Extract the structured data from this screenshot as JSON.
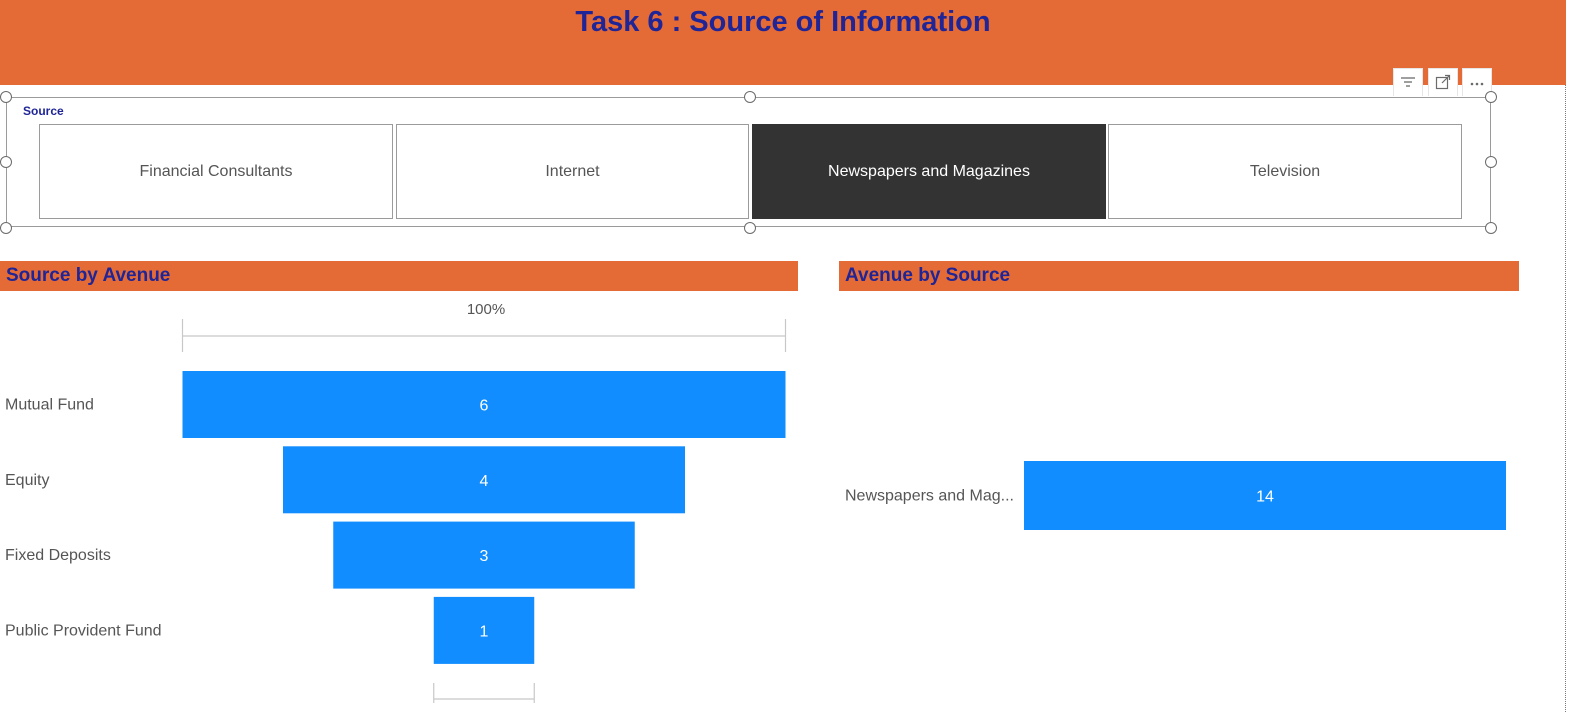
{
  "header": {
    "title": "Task 6 :  Source of Information"
  },
  "toolbar": {
    "filter_icon": "filter-icon",
    "focus_icon": "focus-mode-icon",
    "more_icon": "more-options-icon"
  },
  "slicer": {
    "title": "Source",
    "items": [
      {
        "label": "Financial Consultants",
        "selected": false
      },
      {
        "label": "Internet",
        "selected": false
      },
      {
        "label": "Newspapers and Magazines",
        "selected": true
      },
      {
        "label": "Television",
        "selected": false
      }
    ]
  },
  "colors": {
    "accent": "#e56b36",
    "title": "#1f2596",
    "bar": "#118dff",
    "selected_tile": "#333333"
  },
  "chart_data": [
    {
      "type": "bar",
      "subtype": "funnel",
      "title": "Source by Avenue",
      "top_percent_label": "100%",
      "categories": [
        "Mutual Fund",
        "Equity",
        "Fixed Deposits",
        "Public Provident Fund"
      ],
      "values": [
        6,
        4,
        3,
        1
      ]
    },
    {
      "type": "bar",
      "orientation": "horizontal",
      "title": "Avenue by Source",
      "categories": [
        "Newspapers and Mag..."
      ],
      "values": [
        14
      ]
    }
  ]
}
